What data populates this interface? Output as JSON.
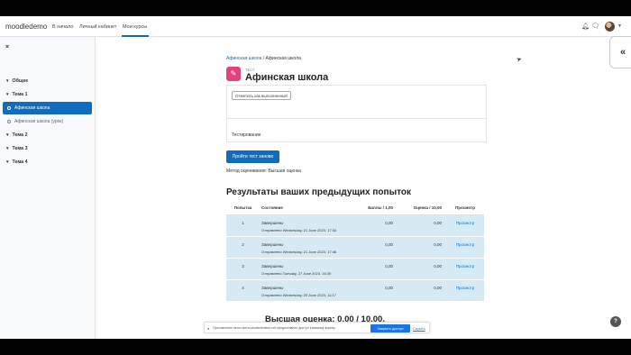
{
  "navbar": {
    "brand": "moodledemo",
    "links": [
      "В начало",
      "Личный кабинет",
      "Мои курсы"
    ],
    "active_link": "Мои курсы",
    "icons": [
      "bell-icon",
      "chat-icon",
      "user-avatar",
      "chevron-down-icon"
    ]
  },
  "sidebar": {
    "close": "×",
    "sections": [
      {
        "label": "Общее"
      },
      {
        "label": "Тема 1"
      },
      {
        "label": "Тема 2"
      },
      {
        "label": "Тема 3"
      },
      {
        "label": "Тема 4"
      }
    ],
    "activities": [
      {
        "label": "Афинская школа",
        "active": true
      },
      {
        "label": "Афинская школа (урок)",
        "active": false
      }
    ]
  },
  "drawer_toggle": "«",
  "breadcrumb": {
    "course": "Афинская школа",
    "separator": "/",
    "current": "Афинская школа"
  },
  "module": {
    "type": "ТЕСТ",
    "title": "Афинская школа",
    "mark_done": "Отметить как выполненный",
    "description": "Тестирование",
    "retake_button": "Пройти тест заново",
    "grading_method": "Метод оценивания: Высшая оценка"
  },
  "results": {
    "heading": "Результаты ваших предыдущих попыток",
    "columns": [
      "Попытка",
      "Состояние",
      "Баллы / 1,00",
      "Оценка / 10,00",
      "Просмотр"
    ],
    "rows": [
      {
        "attempt": "1",
        "state": "Завершены",
        "submitted": "Отправлено Wednesday, 21 June 2023, 17:34",
        "marks": "0,00",
        "grade": "0,00",
        "review": "Просмотр"
      },
      {
        "attempt": "2",
        "state": "Завершены",
        "submitted": "Отправлено Wednesday, 21 June 2023, 17:46",
        "marks": "0,00",
        "grade": "0,00",
        "review": "Просмотр"
      },
      {
        "attempt": "3",
        "state": "Завершены",
        "submitted": "Отправлено Tuesday, 27 June 2023, 16:39",
        "marks": "0,00",
        "grade": "0,00",
        "review": "Просмотр"
      },
      {
        "attempt": "4",
        "state": "Завершены",
        "submitted": "Отправлено Wednesday, 20 June 2023, 11:17",
        "marks": "0,00",
        "grade": "0,00",
        "review": "Просмотр"
      }
    ],
    "highest_grade": "Высшая оценка: 0,00 / 10,00."
  },
  "notification": {
    "text": "Приложению demo.stend.studentmates.net предоставлен доступ к вашему экрану.",
    "open_button": "Закрыть доступ",
    "hide_link": "Скрыть"
  },
  "help": "?",
  "colors": {
    "primary": "#0f6cbf",
    "quiz_icon": "#e5417f",
    "row_bg": "#d6eaf5"
  }
}
